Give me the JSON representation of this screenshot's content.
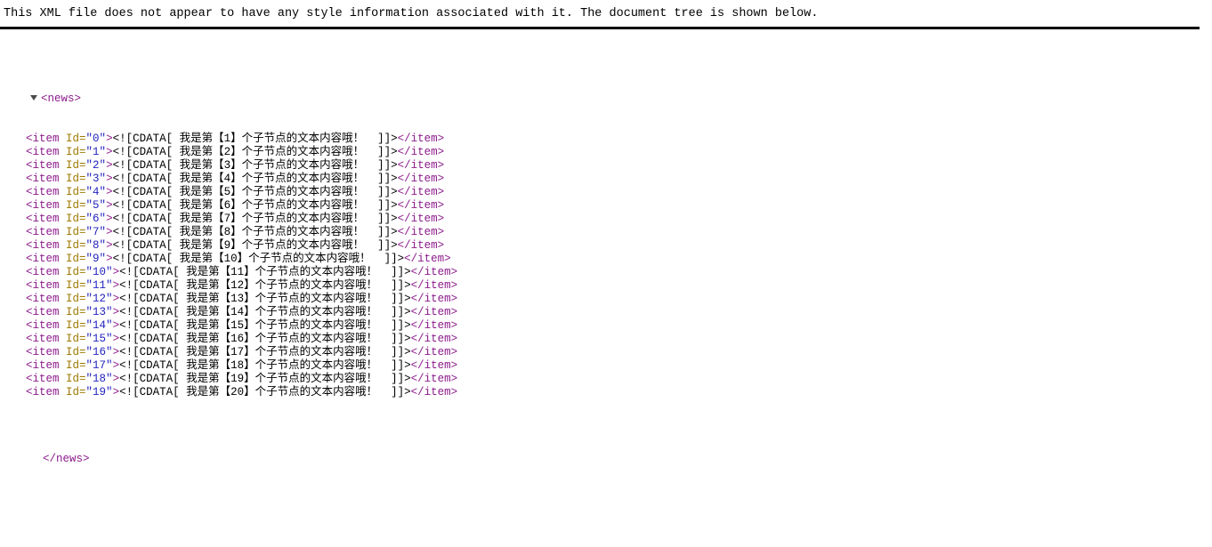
{
  "notice": {
    "message": "This XML file does not appear to have any style information associated with it. The document tree is shown below."
  },
  "colors": {
    "tag": "#8b1a8b",
    "attribute_name": "#9c7a00",
    "attribute_value": "#2424c0",
    "text": "#000000",
    "twisty": "#4a4a4a",
    "background": "#ffffff",
    "rule": "#000000"
  },
  "tree": {
    "twisty_icon": "triangle-down-icon",
    "root_open": "<news>",
    "root_close": "</news>",
    "attribute_name": "Id",
    "cdata_open": "<![CDATA[",
    "cdata_close": "]]>",
    "item_open_prefix": "<item ",
    "item_open_suffix": ">",
    "item_close": "</item>",
    "items": [
      {
        "id": "0",
        "quoted_id": "\"0\"",
        "cdata_text": " 我是第【1】个子节点的文本内容哦！  "
      },
      {
        "id": "1",
        "quoted_id": "\"1\"",
        "cdata_text": " 我是第【2】个子节点的文本内容哦！  "
      },
      {
        "id": "2",
        "quoted_id": "\"2\"",
        "cdata_text": " 我是第【3】个子节点的文本内容哦！  "
      },
      {
        "id": "3",
        "quoted_id": "\"3\"",
        "cdata_text": " 我是第【4】个子节点的文本内容哦！  "
      },
      {
        "id": "4",
        "quoted_id": "\"4\"",
        "cdata_text": " 我是第【5】个子节点的文本内容哦！  "
      },
      {
        "id": "5",
        "quoted_id": "\"5\"",
        "cdata_text": " 我是第【6】个子节点的文本内容哦！  "
      },
      {
        "id": "6",
        "quoted_id": "\"6\"",
        "cdata_text": " 我是第【7】个子节点的文本内容哦！  "
      },
      {
        "id": "7",
        "quoted_id": "\"7\"",
        "cdata_text": " 我是第【8】个子节点的文本内容哦！  "
      },
      {
        "id": "8",
        "quoted_id": "\"8\"",
        "cdata_text": " 我是第【9】个子节点的文本内容哦！  "
      },
      {
        "id": "9",
        "quoted_id": "\"9\"",
        "cdata_text": " 我是第【10】个子节点的文本内容哦！  "
      },
      {
        "id": "10",
        "quoted_id": "\"10\"",
        "cdata_text": " 我是第【11】个子节点的文本内容哦！  "
      },
      {
        "id": "11",
        "quoted_id": "\"11\"",
        "cdata_text": " 我是第【12】个子节点的文本内容哦！  "
      },
      {
        "id": "12",
        "quoted_id": "\"12\"",
        "cdata_text": " 我是第【13】个子节点的文本内容哦！  "
      },
      {
        "id": "13",
        "quoted_id": "\"13\"",
        "cdata_text": " 我是第【14】个子节点的文本内容哦！  "
      },
      {
        "id": "14",
        "quoted_id": "\"14\"",
        "cdata_text": " 我是第【15】个子节点的文本内容哦！  "
      },
      {
        "id": "15",
        "quoted_id": "\"15\"",
        "cdata_text": " 我是第【16】个子节点的文本内容哦！  "
      },
      {
        "id": "16",
        "quoted_id": "\"16\"",
        "cdata_text": " 我是第【17】个子节点的文本内容哦！  "
      },
      {
        "id": "17",
        "quoted_id": "\"17\"",
        "cdata_text": " 我是第【18】个子节点的文本内容哦！  "
      },
      {
        "id": "18",
        "quoted_id": "\"18\"",
        "cdata_text": " 我是第【19】个子节点的文本内容哦！  "
      },
      {
        "id": "19",
        "quoted_id": "\"19\"",
        "cdata_text": " 我是第【20】个子节点的文本内容哦！  "
      }
    ]
  }
}
